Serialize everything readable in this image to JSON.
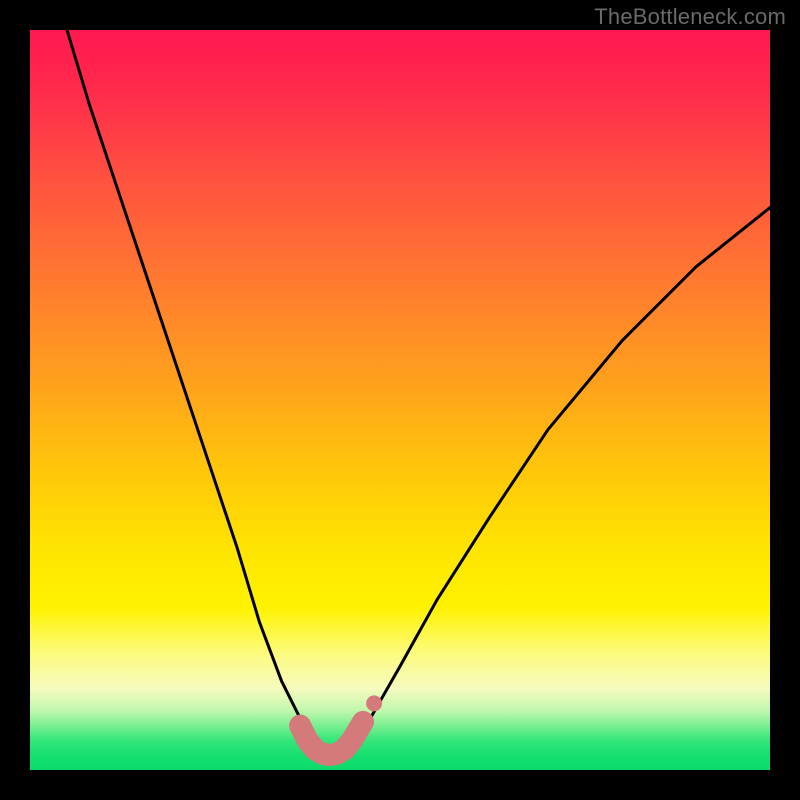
{
  "watermark": "TheBottleneck.com",
  "chart_data": {
    "type": "line",
    "title": "",
    "xlabel": "",
    "ylabel": "",
    "xlim": [
      0,
      100
    ],
    "ylim": [
      0,
      100
    ],
    "grid": false,
    "series": [
      {
        "name": "bottleneck-curve",
        "x": [
          5,
          8,
          12,
          16,
          20,
          24,
          28,
          31,
          34,
          36,
          38,
          40,
          42,
          44,
          46,
          50,
          55,
          62,
          70,
          80,
          90,
          100
        ],
        "y": [
          100,
          90,
          78,
          66,
          54,
          42,
          30,
          20,
          12,
          8,
          4,
          2,
          2,
          4,
          7,
          14,
          23,
          34,
          46,
          58,
          68,
          76
        ]
      }
    ],
    "markers": {
      "name": "highlight-band",
      "color": "#d47a7a",
      "points": [
        {
          "x": 36.5,
          "y": 6.0
        },
        {
          "x": 37.5,
          "y": 4.0
        },
        {
          "x": 38.5,
          "y": 2.8
        },
        {
          "x": 39.5,
          "y": 2.2
        },
        {
          "x": 40.5,
          "y": 2.0
        },
        {
          "x": 41.5,
          "y": 2.2
        },
        {
          "x": 42.5,
          "y": 2.8
        },
        {
          "x": 43.5,
          "y": 4.0
        },
        {
          "x": 45.0,
          "y": 6.5
        }
      ]
    },
    "background_gradient": {
      "top": "#ff1850",
      "mid": "#ffe402",
      "bottom": "#0bdc6b"
    }
  }
}
